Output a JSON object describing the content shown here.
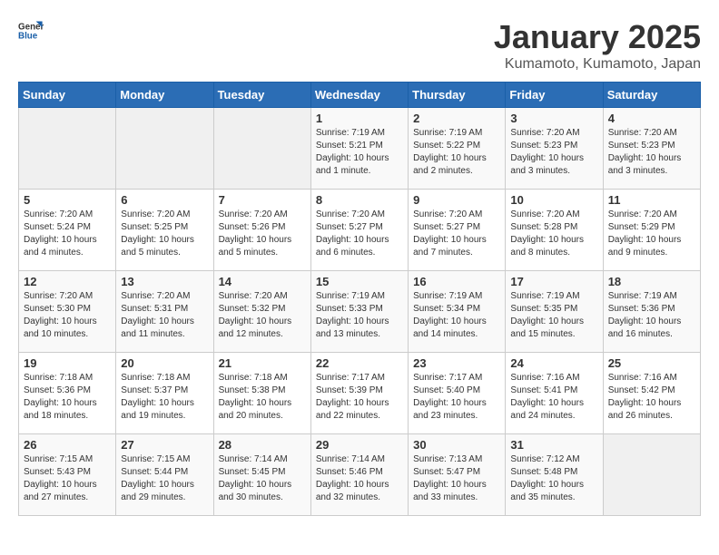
{
  "header": {
    "logo_general": "General",
    "logo_blue": "Blue",
    "month": "January 2025",
    "location": "Kumamoto, Kumamoto, Japan"
  },
  "weekdays": [
    "Sunday",
    "Monday",
    "Tuesday",
    "Wednesday",
    "Thursday",
    "Friday",
    "Saturday"
  ],
  "weeks": [
    [
      {
        "day": "",
        "sunrise": "",
        "sunset": "",
        "daylight": ""
      },
      {
        "day": "",
        "sunrise": "",
        "sunset": "",
        "daylight": ""
      },
      {
        "day": "",
        "sunrise": "",
        "sunset": "",
        "daylight": ""
      },
      {
        "day": "1",
        "sunrise": "Sunrise: 7:19 AM",
        "sunset": "Sunset: 5:21 PM",
        "daylight": "Daylight: 10 hours and 1 minute."
      },
      {
        "day": "2",
        "sunrise": "Sunrise: 7:19 AM",
        "sunset": "Sunset: 5:22 PM",
        "daylight": "Daylight: 10 hours and 2 minutes."
      },
      {
        "day": "3",
        "sunrise": "Sunrise: 7:20 AM",
        "sunset": "Sunset: 5:23 PM",
        "daylight": "Daylight: 10 hours and 3 minutes."
      },
      {
        "day": "4",
        "sunrise": "Sunrise: 7:20 AM",
        "sunset": "Sunset: 5:23 PM",
        "daylight": "Daylight: 10 hours and 3 minutes."
      }
    ],
    [
      {
        "day": "5",
        "sunrise": "Sunrise: 7:20 AM",
        "sunset": "Sunset: 5:24 PM",
        "daylight": "Daylight: 10 hours and 4 minutes."
      },
      {
        "day": "6",
        "sunrise": "Sunrise: 7:20 AM",
        "sunset": "Sunset: 5:25 PM",
        "daylight": "Daylight: 10 hours and 5 minutes."
      },
      {
        "day": "7",
        "sunrise": "Sunrise: 7:20 AM",
        "sunset": "Sunset: 5:26 PM",
        "daylight": "Daylight: 10 hours and 5 minutes."
      },
      {
        "day": "8",
        "sunrise": "Sunrise: 7:20 AM",
        "sunset": "Sunset: 5:27 PM",
        "daylight": "Daylight: 10 hours and 6 minutes."
      },
      {
        "day": "9",
        "sunrise": "Sunrise: 7:20 AM",
        "sunset": "Sunset: 5:27 PM",
        "daylight": "Daylight: 10 hours and 7 minutes."
      },
      {
        "day": "10",
        "sunrise": "Sunrise: 7:20 AM",
        "sunset": "Sunset: 5:28 PM",
        "daylight": "Daylight: 10 hours and 8 minutes."
      },
      {
        "day": "11",
        "sunrise": "Sunrise: 7:20 AM",
        "sunset": "Sunset: 5:29 PM",
        "daylight": "Daylight: 10 hours and 9 minutes."
      }
    ],
    [
      {
        "day": "12",
        "sunrise": "Sunrise: 7:20 AM",
        "sunset": "Sunset: 5:30 PM",
        "daylight": "Daylight: 10 hours and 10 minutes."
      },
      {
        "day": "13",
        "sunrise": "Sunrise: 7:20 AM",
        "sunset": "Sunset: 5:31 PM",
        "daylight": "Daylight: 10 hours and 11 minutes."
      },
      {
        "day": "14",
        "sunrise": "Sunrise: 7:20 AM",
        "sunset": "Sunset: 5:32 PM",
        "daylight": "Daylight: 10 hours and 12 minutes."
      },
      {
        "day": "15",
        "sunrise": "Sunrise: 7:19 AM",
        "sunset": "Sunset: 5:33 PM",
        "daylight": "Daylight: 10 hours and 13 minutes."
      },
      {
        "day": "16",
        "sunrise": "Sunrise: 7:19 AM",
        "sunset": "Sunset: 5:34 PM",
        "daylight": "Daylight: 10 hours and 14 minutes."
      },
      {
        "day": "17",
        "sunrise": "Sunrise: 7:19 AM",
        "sunset": "Sunset: 5:35 PM",
        "daylight": "Daylight: 10 hours and 15 minutes."
      },
      {
        "day": "18",
        "sunrise": "Sunrise: 7:19 AM",
        "sunset": "Sunset: 5:36 PM",
        "daylight": "Daylight: 10 hours and 16 minutes."
      }
    ],
    [
      {
        "day": "19",
        "sunrise": "Sunrise: 7:18 AM",
        "sunset": "Sunset: 5:36 PM",
        "daylight": "Daylight: 10 hours and 18 minutes."
      },
      {
        "day": "20",
        "sunrise": "Sunrise: 7:18 AM",
        "sunset": "Sunset: 5:37 PM",
        "daylight": "Daylight: 10 hours and 19 minutes."
      },
      {
        "day": "21",
        "sunrise": "Sunrise: 7:18 AM",
        "sunset": "Sunset: 5:38 PM",
        "daylight": "Daylight: 10 hours and 20 minutes."
      },
      {
        "day": "22",
        "sunrise": "Sunrise: 7:17 AM",
        "sunset": "Sunset: 5:39 PM",
        "daylight": "Daylight: 10 hours and 22 minutes."
      },
      {
        "day": "23",
        "sunrise": "Sunrise: 7:17 AM",
        "sunset": "Sunset: 5:40 PM",
        "daylight": "Daylight: 10 hours and 23 minutes."
      },
      {
        "day": "24",
        "sunrise": "Sunrise: 7:16 AM",
        "sunset": "Sunset: 5:41 PM",
        "daylight": "Daylight: 10 hours and 24 minutes."
      },
      {
        "day": "25",
        "sunrise": "Sunrise: 7:16 AM",
        "sunset": "Sunset: 5:42 PM",
        "daylight": "Daylight: 10 hours and 26 minutes."
      }
    ],
    [
      {
        "day": "26",
        "sunrise": "Sunrise: 7:15 AM",
        "sunset": "Sunset: 5:43 PM",
        "daylight": "Daylight: 10 hours and 27 minutes."
      },
      {
        "day": "27",
        "sunrise": "Sunrise: 7:15 AM",
        "sunset": "Sunset: 5:44 PM",
        "daylight": "Daylight: 10 hours and 29 minutes."
      },
      {
        "day": "28",
        "sunrise": "Sunrise: 7:14 AM",
        "sunset": "Sunset: 5:45 PM",
        "daylight": "Daylight: 10 hours and 30 minutes."
      },
      {
        "day": "29",
        "sunrise": "Sunrise: 7:14 AM",
        "sunset": "Sunset: 5:46 PM",
        "daylight": "Daylight: 10 hours and 32 minutes."
      },
      {
        "day": "30",
        "sunrise": "Sunrise: 7:13 AM",
        "sunset": "Sunset: 5:47 PM",
        "daylight": "Daylight: 10 hours and 33 minutes."
      },
      {
        "day": "31",
        "sunrise": "Sunrise: 7:12 AM",
        "sunset": "Sunset: 5:48 PM",
        "daylight": "Daylight: 10 hours and 35 minutes."
      },
      {
        "day": "",
        "sunrise": "",
        "sunset": "",
        "daylight": ""
      }
    ]
  ]
}
